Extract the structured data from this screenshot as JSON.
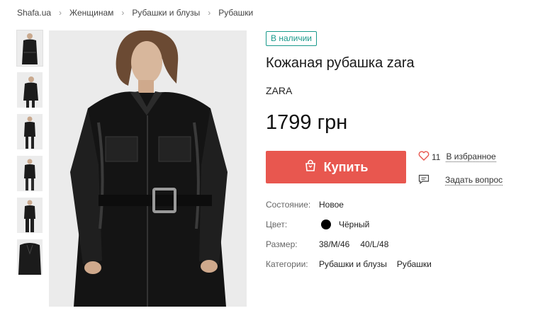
{
  "breadcrumb": {
    "items": [
      "Shafa.ua",
      "Женщинам",
      "Рубашки и блузы",
      "Рубашки"
    ],
    "separator": "›"
  },
  "gallery": {
    "thumbnail_count": 6,
    "active_index": 0
  },
  "product": {
    "stock_label": "В наличии",
    "title": "Кожаная рубашка zara",
    "brand": "ZARA",
    "price": "1799 грн"
  },
  "actions": {
    "buy_label": "Купить",
    "favorites_count": "11",
    "favorites_label": "В избранное",
    "ask_label": "Задать вопрос"
  },
  "properties": {
    "condition_label": "Состояние:",
    "condition_value": "Новое",
    "color_label": "Цвет:",
    "color_value": "Чёрный",
    "color_swatch": "#000000",
    "size_label": "Размер:",
    "sizes": [
      "38/M/46",
      "40/L/48"
    ],
    "category_label": "Категории:",
    "categories": [
      "Рубашки и блузы",
      "Рубашки"
    ]
  },
  "colors": {
    "accent_buy": "#e8574f",
    "stock_badge": "#1a9a8c"
  },
  "icons": {
    "buy": "shopping-bag-icon",
    "favorite": "heart-icon",
    "ask": "chat-bubble-icon",
    "separator": "chevron-right-icon"
  }
}
